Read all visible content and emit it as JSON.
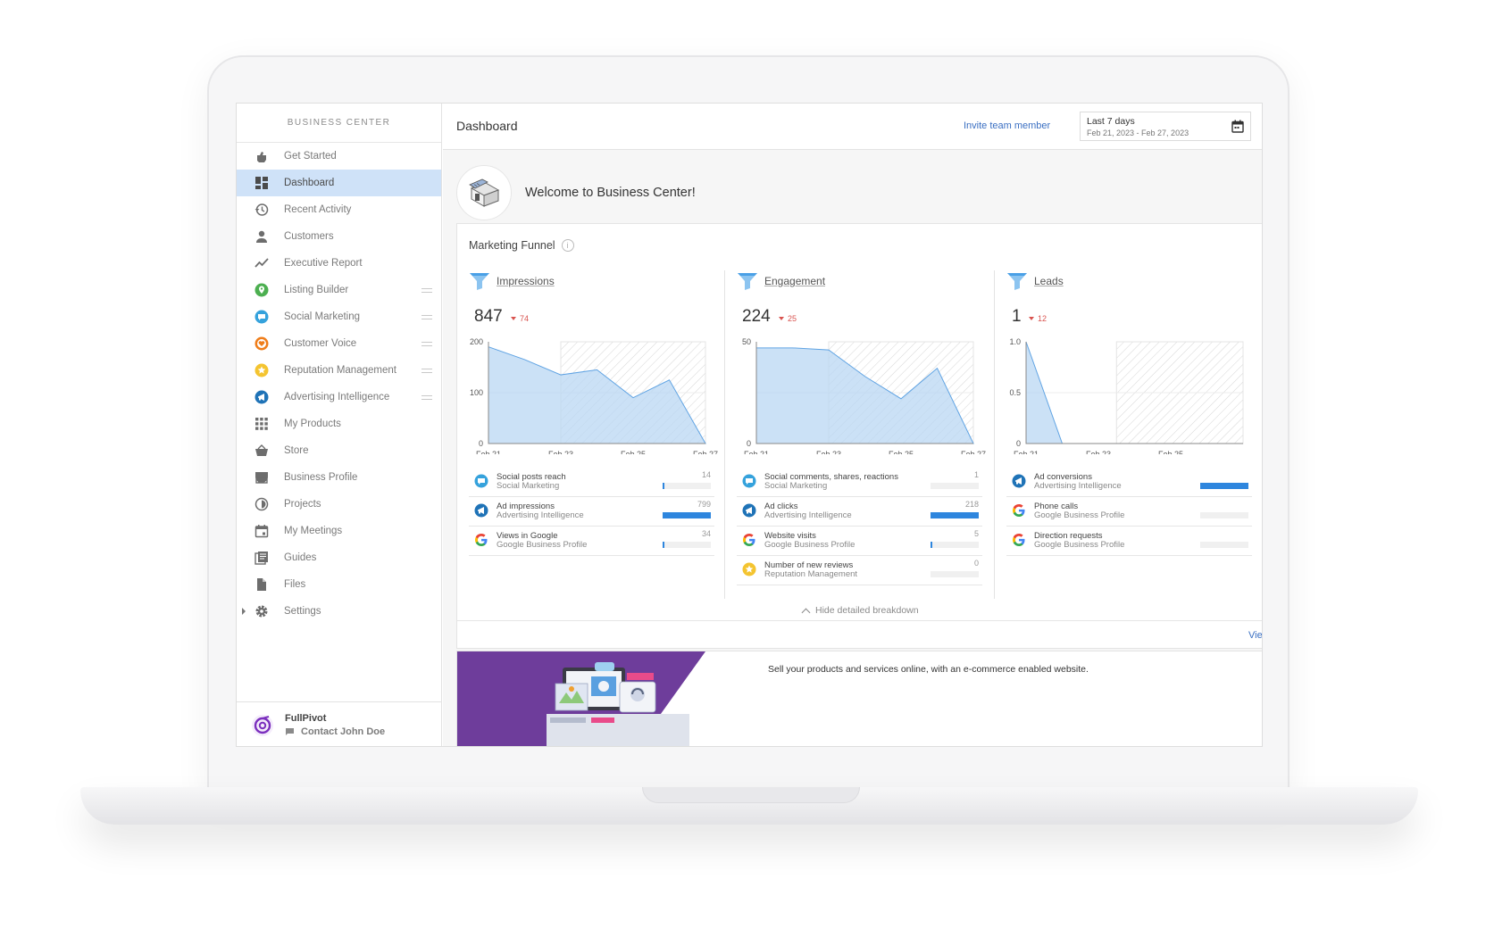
{
  "sidebar": {
    "brand": "BUSINESS CENTER",
    "items": [
      {
        "label": "Get Started",
        "icon": "hand-icon"
      },
      {
        "label": "Dashboard",
        "icon": "dashboard-icon",
        "active": true
      },
      {
        "label": "Recent Activity",
        "icon": "history-icon"
      },
      {
        "label": "Customers",
        "icon": "person-icon"
      },
      {
        "label": "Executive Report",
        "icon": "trend-icon"
      },
      {
        "label": "Listing Builder",
        "icon": "pin-icon",
        "color": "#4caf50"
      },
      {
        "label": "Social Marketing",
        "icon": "chat-icon",
        "color": "#35a2dc"
      },
      {
        "label": "Customer Voice",
        "icon": "heart-icon",
        "color": "#ef7d1a"
      },
      {
        "label": "Reputation Management",
        "icon": "star-icon",
        "color": "#f4c430"
      },
      {
        "label": "Advertising Intelligence",
        "icon": "megaphone-icon",
        "color": "#1f73b7"
      },
      {
        "label": "My Products",
        "icon": "grid-icon"
      },
      {
        "label": "Store",
        "icon": "basket-icon"
      },
      {
        "label": "Business Profile",
        "icon": "storefront-icon"
      },
      {
        "label": "Projects",
        "icon": "clock-icon"
      },
      {
        "label": "My Meetings",
        "icon": "calendar-icon"
      },
      {
        "label": "Guides",
        "icon": "book-icon"
      },
      {
        "label": "Files",
        "icon": "file-icon"
      },
      {
        "label": "Settings",
        "icon": "gear-icon"
      }
    ],
    "footer": {
      "name": "FullPivot",
      "contact": "Contact John Doe"
    }
  },
  "header": {
    "title": "Dashboard",
    "invite": "Invite team member",
    "date_label": "Last 7 days",
    "date_range": "Feb 21, 2023 - Feb 27, 2023"
  },
  "welcome": {
    "title": "Welcome to Business Center!"
  },
  "funnel": {
    "title": "Marketing Funnel",
    "hide_label": "Hide detailed breakdown",
    "view_label": "View"
  },
  "chart_data": [
    {
      "type": "area",
      "title": "Impressions",
      "total": "847",
      "delta": "74",
      "x": [
        "Feb 21",
        "Feb 22",
        "Feb 23",
        "Feb 24",
        "Feb 25",
        "Feb 26",
        "Feb 27"
      ],
      "values": [
        190,
        165,
        135,
        145,
        90,
        125,
        0
      ],
      "ylim": [
        0,
        200
      ],
      "yticks": [
        "200",
        "100",
        "0"
      ],
      "xticks": [
        "Feb 21",
        "Feb 23",
        "Feb 25",
        "Feb 27"
      ],
      "color": "#b9d7f3",
      "metrics": [
        {
          "name": "Social posts reach",
          "source": "Social Marketing",
          "value": "14",
          "fraction": 0.02,
          "icon": "chat-icon"
        },
        {
          "name": "Ad impressions",
          "source": "Advertising Intelligence",
          "value": "799",
          "fraction": 1.0,
          "icon": "megaphone-icon"
        },
        {
          "name": "Views in Google",
          "source": "Google Business Profile",
          "value": "34",
          "fraction": 0.04,
          "icon": "google-icon"
        }
      ]
    },
    {
      "type": "area",
      "title": "Engagement",
      "total": "224",
      "delta": "25",
      "x": [
        "Feb 21",
        "Feb 22",
        "Feb 23",
        "Feb 24",
        "Feb 25",
        "Feb 26",
        "Feb 27"
      ],
      "values": [
        47,
        47,
        46,
        33,
        22,
        37,
        0
      ],
      "ylim": [
        0,
        50
      ],
      "yticks": [
        "50",
        "",
        "0"
      ],
      "xticks": [
        "Feb 21",
        "Feb 23",
        "Feb 25",
        "Feb 27"
      ],
      "color": "#b9d7f3",
      "metrics": [
        {
          "name": "Social comments, shares, reactions",
          "source": "Social Marketing",
          "value": "1",
          "fraction": 0.0,
          "icon": "chat-icon"
        },
        {
          "name": "Ad clicks",
          "source": "Advertising Intelligence",
          "value": "218",
          "fraction": 1.0,
          "icon": "megaphone-icon"
        },
        {
          "name": "Website visits",
          "source": "Google Business Profile",
          "value": "5",
          "fraction": 0.02,
          "icon": "google-icon"
        },
        {
          "name": "Number of new reviews",
          "source": "Reputation Management",
          "value": "0",
          "fraction": 0.0,
          "icon": "star-icon"
        }
      ]
    },
    {
      "type": "area",
      "title": "Leads",
      "total": "1",
      "delta": "12",
      "x": [
        "Feb 21",
        "Feb 22",
        "Feb 23",
        "Feb 24",
        "Feb 25"
      ],
      "values": [
        1,
        0,
        0,
        0,
        0
      ],
      "ylim": [
        0,
        1
      ],
      "yticks": [
        "1.0",
        "0.5",
        "0"
      ],
      "xticks": [
        "Feb 21",
        "Feb 23",
        "Feb 25"
      ],
      "color": "#b9d7f3",
      "metrics": [
        {
          "name": "Ad conversions",
          "source": "Advertising Intelligence",
          "value": "",
          "fraction": 1.0,
          "icon": "megaphone-icon"
        },
        {
          "name": "Phone calls",
          "source": "Google Business Profile",
          "value": "",
          "fraction": 0.0,
          "icon": "google-icon"
        },
        {
          "name": "Direction requests",
          "source": "Google Business Profile",
          "value": "",
          "fraction": 0.0,
          "icon": "google-icon"
        }
      ]
    }
  ],
  "promo": {
    "text": "Sell your products and services online, with an e-commerce enabled website."
  }
}
